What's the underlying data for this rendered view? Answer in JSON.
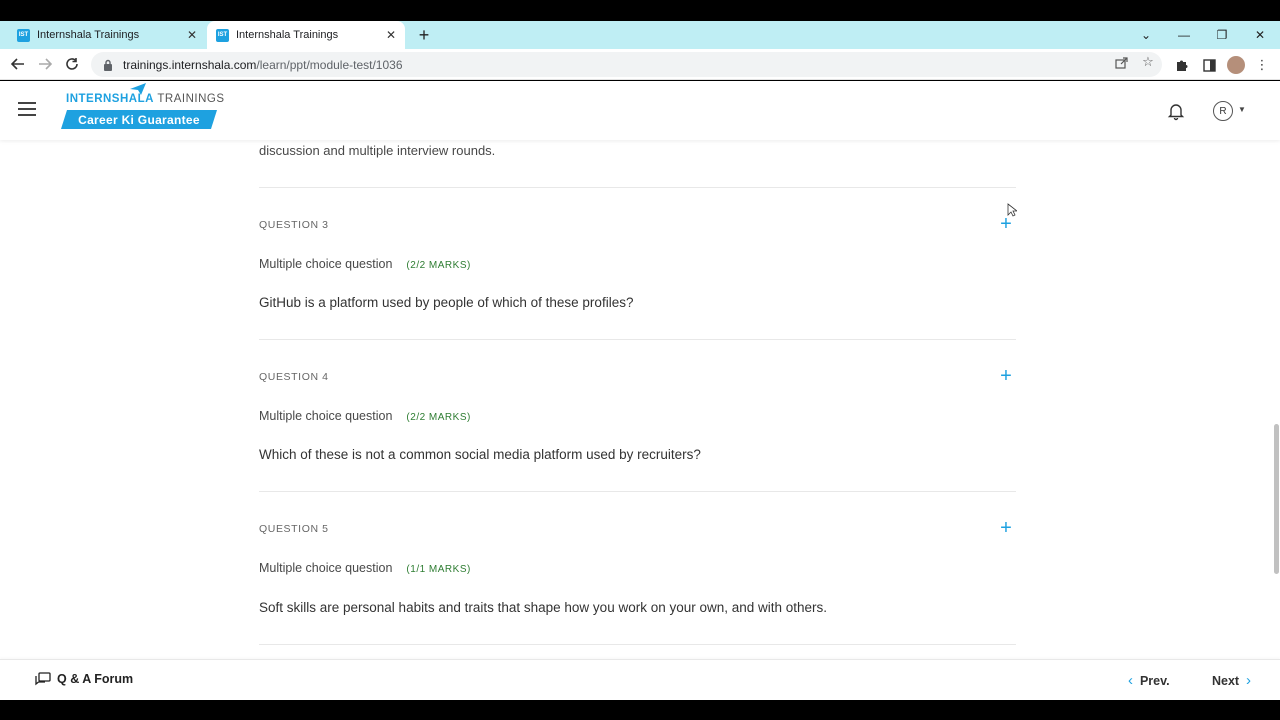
{
  "browser": {
    "tabs": [
      {
        "favicon": "IST",
        "title": "Internshala Trainings",
        "active": false
      },
      {
        "favicon": "IST",
        "title": "Internshala Trainings",
        "active": true
      }
    ],
    "url_host": "trainings.internshala.com",
    "url_path": "/learn/ppt/module-test/1036"
  },
  "header": {
    "logo_bold": "INTERNSHALA",
    "logo_light": " TRAININGS",
    "tagline": "Career Ki Guarantee",
    "avatar_initial": "R"
  },
  "previous_fragment": "discussion and multiple interview rounds.",
  "questions": [
    {
      "label": "QUESTION 3",
      "type": "Multiple choice question",
      "marks": "(2/2 MARKS)",
      "text": "GitHub is a platform used by people of which of these profiles?"
    },
    {
      "label": "QUESTION 4",
      "type": "Multiple choice question",
      "marks": "(2/2 MARKS)",
      "text": "Which of these is not a common social media platform used by recruiters?"
    },
    {
      "label": "QUESTION 5",
      "type": "Multiple choice question",
      "marks": "(1/1 MARKS)",
      "text": "Soft skills are personal habits and traits that shape how you work on your own, and with others."
    }
  ],
  "footer": {
    "forum_label": "Q & A Forum",
    "prev_label": "Prev.",
    "next_label": "Next"
  },
  "colors": {
    "brand": "#1ea1e0",
    "marks": "#2e7d32",
    "tabstrip": "#bfeef4"
  }
}
